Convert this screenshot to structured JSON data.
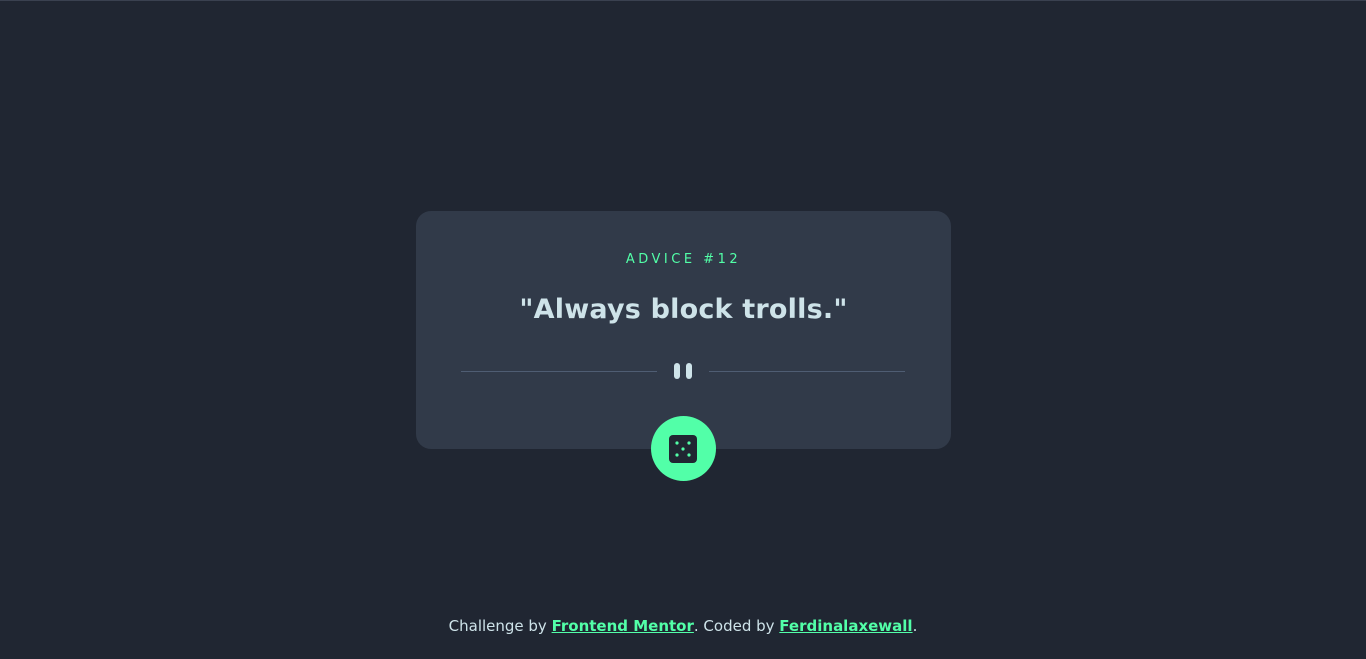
{
  "card": {
    "advice_label": "ADVICE #12",
    "quote": "\"Always block trolls.\""
  },
  "icons": {
    "divider": "pause-icon",
    "button": "dice-icon"
  },
  "footer": {
    "prefix": "Challenge by ",
    "mentor_link": "Frontend Mentor",
    "middle": ". Coded by ",
    "author_link": "Ferdinalaxewall",
    "suffix": "."
  },
  "colors": {
    "background": "#202632",
    "card": "#313a49",
    "accent": "#52ffa8",
    "text": "#cee3e9",
    "divider": "#4f5d73"
  }
}
